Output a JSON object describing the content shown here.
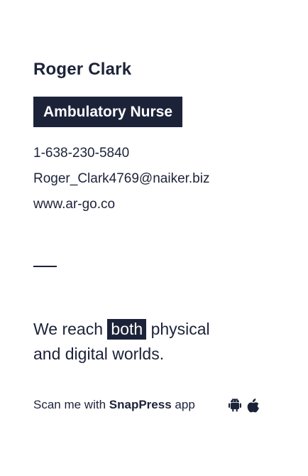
{
  "card": {
    "name": "Roger Clark",
    "job_title": "Ambulatory Nurse",
    "phone": "1-638-230-5840",
    "email": "Roger_Clark4769@naiker.biz",
    "website": "www.ar-go.co"
  },
  "tagline": {
    "before": "We reach",
    "highlight": "both",
    "after": "physical",
    "line2": "and digital worlds."
  },
  "scan": {
    "prefix": "Scan me with",
    "brand": "SnapPress",
    "suffix": "app"
  },
  "icons": [
    "android-icon",
    "apple-icon"
  ],
  "colors": {
    "ink": "#1c2339",
    "background": "#ffffff",
    "badge_text": "#ffffff"
  }
}
